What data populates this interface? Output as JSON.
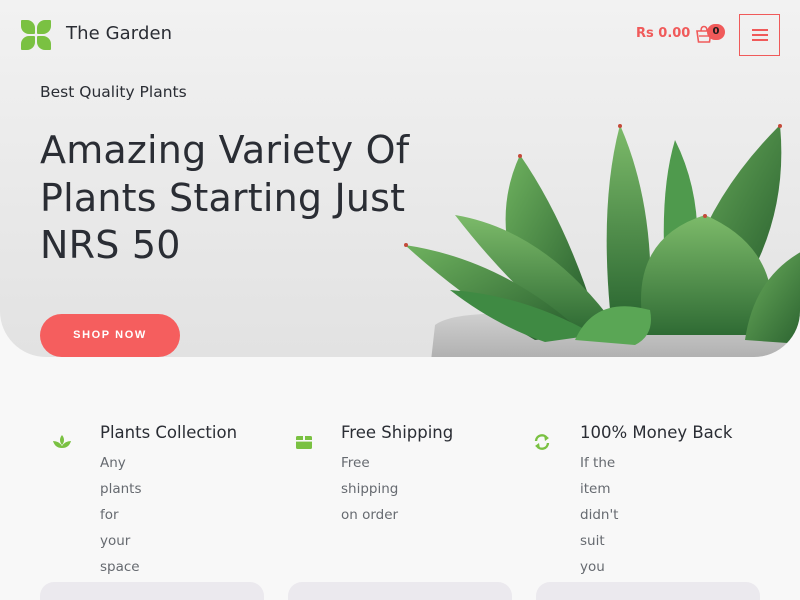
{
  "brand": {
    "name": "The Garden",
    "accent_color": "#f05a5a",
    "logo_color": "#7ac142"
  },
  "header": {
    "cart_total": "Rs 0.00",
    "cart_count": "0",
    "cart_icon": "shopping-bag-icon",
    "menu_icon": "hamburger-menu-icon"
  },
  "hero": {
    "tagline": "Best Quality Plants",
    "headline_lines": [
      "Amazing Variety Of",
      "Plants Starting Just",
      "NRS 50"
    ],
    "cta_label": "SHOP NOW",
    "image": "succulent-plant-image"
  },
  "features": [
    {
      "icon": "leaf-sprout-icon",
      "title": "Plants Collection",
      "desc_lines": [
        "Any plants for your",
        "space"
      ]
    },
    {
      "icon": "box-icon",
      "title": "Free Shipping",
      "desc_lines": [
        "Free shipping on order"
      ]
    },
    {
      "icon": "refresh-icon",
      "title": "100% Money Back",
      "desc_lines": [
        "If the item didn't suit",
        "you"
      ]
    }
  ]
}
